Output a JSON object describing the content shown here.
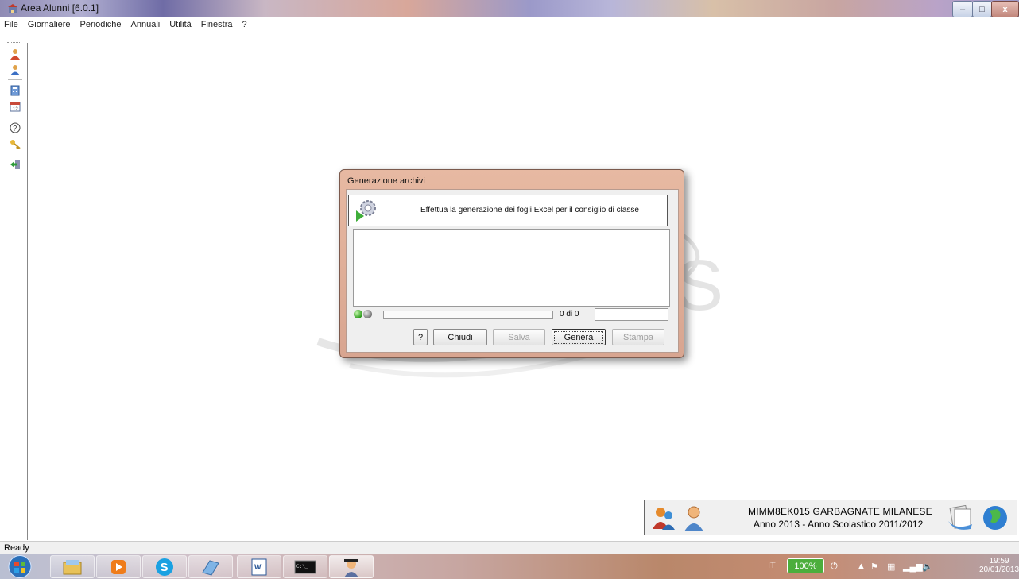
{
  "window": {
    "title": "Area Alunni [6.0.1]",
    "controls": {
      "minimize": "–",
      "maximize": "□",
      "close": "x"
    }
  },
  "menu": [
    "File",
    "Giornaliere",
    "Periodiche",
    "Annuali",
    "Utilità",
    "Finestra",
    "?"
  ],
  "toolbar_icons": [
    "user-icon",
    "user-add-icon",
    "calculator-icon",
    "calendar-icon",
    "help-icon",
    "key-icon",
    "exit-icon"
  ],
  "dialog": {
    "title": "Generazione archivi",
    "header_text": "Effettua la generazione dei fogli Excel per il consiglio di classe",
    "progress_fraction": 0,
    "counter": "0 di 0",
    "buttons": {
      "help": "?",
      "close": "Chiudi",
      "save": "Salva",
      "generate": "Genera",
      "print": "Stampa"
    }
  },
  "info_panel": {
    "line1": "MIMM8EK015  GARBAGNATE MILANESE",
    "line2": "Anno 2013  -  Anno Scolastico 2011/2012"
  },
  "status": "Ready",
  "taskbar": {
    "apps": [
      "start-orb-icon",
      "file-explorer-icon",
      "media-player-icon",
      "skype-icon",
      "notepad-icon",
      "word-icon",
      "command-prompt-icon",
      "area-alunni-icon"
    ],
    "tray": {
      "language": "IT",
      "battery": "100%",
      "time": "19:59",
      "date": "20/01/2013"
    }
  },
  "colors": {
    "dialog_frame": "#dfae98",
    "led_green": "#2d9b1c",
    "battery_green": "#4cae3c"
  }
}
